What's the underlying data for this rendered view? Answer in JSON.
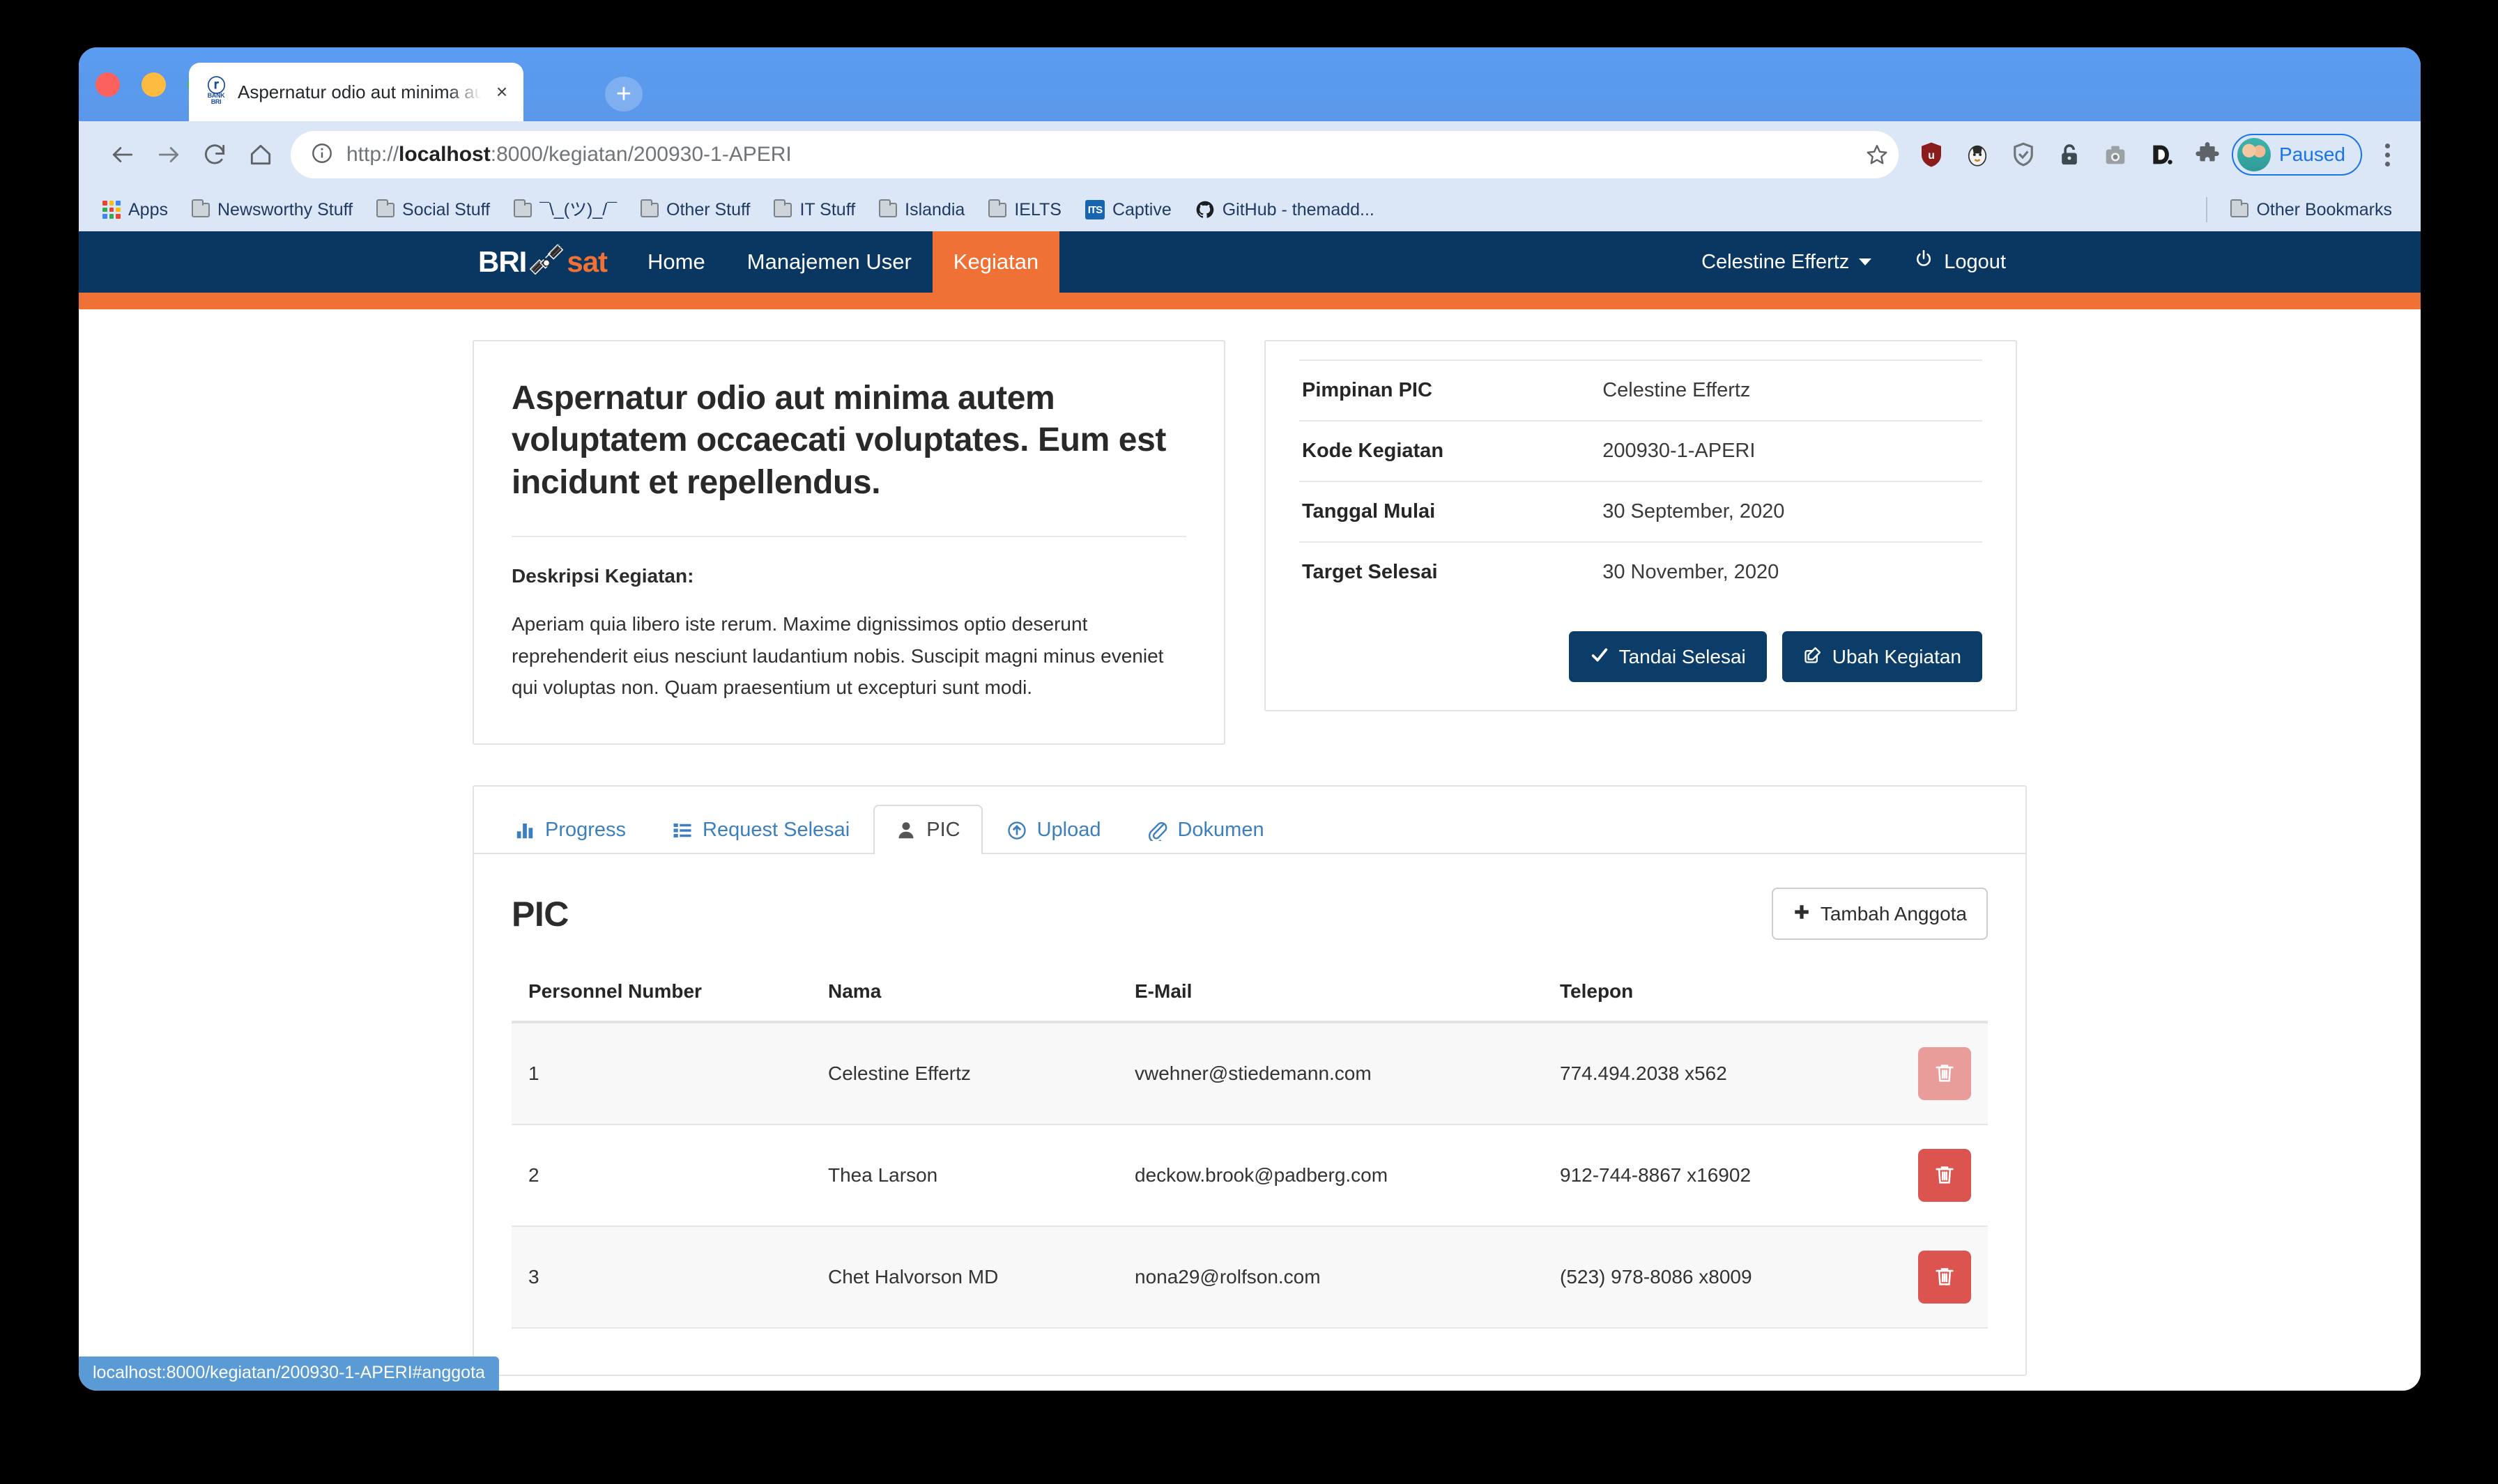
{
  "browser": {
    "tab": {
      "title": "Aspernatur odio aut minima aut",
      "favicon_text": "BRI",
      "favicon_sub": "BANK BRI",
      "close_label": "×"
    },
    "newtab_label": "+",
    "omnibox": {
      "scheme": "http://",
      "host": "localhost",
      "rest": ":8000/kegiatan/200930-1-APERI",
      "full_url": "http://localhost:8000/kegiatan/200930-1-APERI"
    },
    "profile": {
      "label": "Paused"
    },
    "bookmarks": [
      {
        "label": "Apps",
        "icon": "apps-grid-icon"
      },
      {
        "label": "Newsworthy Stuff",
        "icon": "folder-icon"
      },
      {
        "label": "Social Stuff",
        "icon": "folder-icon"
      },
      {
        "label": "¯\\_(ツ)_/¯",
        "icon": "folder-icon"
      },
      {
        "label": "Other Stuff",
        "icon": "folder-icon"
      },
      {
        "label": "IT Stuff",
        "icon": "folder-icon"
      },
      {
        "label": "Islandia",
        "icon": "folder-icon"
      },
      {
        "label": "IELTS",
        "icon": "folder-icon"
      },
      {
        "label": "Captive",
        "icon": "captive-icon"
      },
      {
        "label": "GitHub - themadd...",
        "icon": "github-icon"
      }
    ],
    "other_bookmarks": "Other Bookmarks",
    "status_bubble": "localhost:8000/kegiatan/200930-1-APERI#anggota"
  },
  "colors": {
    "navy": "#0a3761",
    "orange": "#ef7135",
    "link_blue": "#3c7fbf",
    "danger": "#dc5450"
  },
  "navbar": {
    "brand_primary": "BRI",
    "brand_secondary": "sat",
    "links": [
      {
        "label": "Home",
        "active": false
      },
      {
        "label": "Manajemen User",
        "active": false
      },
      {
        "label": "Kegiatan",
        "active": true
      }
    ],
    "user": "Celestine Effertz",
    "logout": "Logout"
  },
  "kegiatan": {
    "title": "Aspernatur odio aut minima autem voluptatem occaecati voluptates. Eum est incidunt et repellendus.",
    "description_label": "Deskripsi Kegiatan:",
    "description": "Aperiam quia libero iste rerum. Maxime dignissimos optio deserunt reprehenderit eius nesciunt laudantium nobis. Suscipit magni minus eveniet qui voluptas non. Quam praesentium ut excepturi sunt modi."
  },
  "info": {
    "rows": [
      {
        "label": "Pimpinan PIC",
        "value": "Celestine Effertz"
      },
      {
        "label": "Kode Kegiatan",
        "value": "200930-1-APERI"
      },
      {
        "label": "Tanggal Mulai",
        "value": "30 September, 2020"
      },
      {
        "label": "Target Selesai",
        "value": "30 November, 2020"
      }
    ],
    "btn_selesai": "Tandai Selesai",
    "btn_ubah": "Ubah Kegiatan"
  },
  "tabs": [
    {
      "label": "Progress",
      "icon": "bar-chart-icon",
      "active": false
    },
    {
      "label": "Request Selesai",
      "icon": "list-icon",
      "active": false
    },
    {
      "label": "PIC",
      "icon": "user-icon",
      "active": true
    },
    {
      "label": "Upload",
      "icon": "upload-circle-icon",
      "active": false
    },
    {
      "label": "Dokumen",
      "icon": "paperclip-icon",
      "active": false
    }
  ],
  "pic": {
    "heading": "PIC",
    "add_button": "Tambah Anggota",
    "columns": [
      "Personnel Number",
      "Nama",
      "E-Mail",
      "Telepon"
    ],
    "rows": [
      {
        "number": "1",
        "nama": "Celestine Effertz",
        "email": "vwehner@stiedemann.com",
        "telepon": "774.494.2038 x562",
        "delete_faded": true
      },
      {
        "number": "2",
        "nama": "Thea Larson",
        "email": "deckow.brook@padberg.com",
        "telepon": "912-744-8867 x16902",
        "delete_faded": false
      },
      {
        "number": "3",
        "nama": "Chet Halvorson MD",
        "email": "nona29@rolfson.com",
        "telepon": "(523) 978-8086 x8009",
        "delete_faded": false
      }
    ]
  }
}
